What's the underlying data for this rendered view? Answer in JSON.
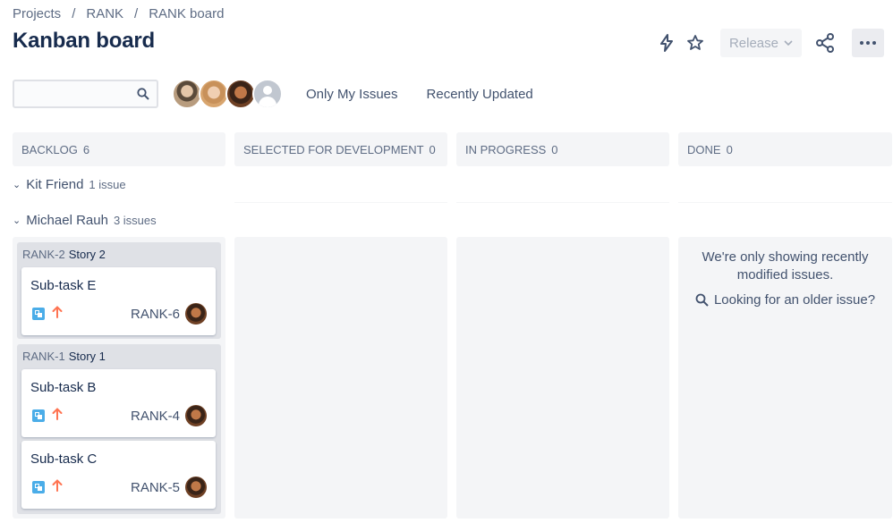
{
  "breadcrumb": [
    "Projects",
    "RANK",
    "RANK board"
  ],
  "page_title": "Kanban board",
  "toolbar": {
    "release_label": "Release",
    "icons": [
      "lightning-icon",
      "star-icon",
      "chevron-down-icon",
      "share-icon",
      "more-icon"
    ]
  },
  "filters": {
    "search_placeholder": "",
    "quick_filters": [
      "Only My Issues",
      "Recently Updated"
    ]
  },
  "columns": [
    {
      "name": "BACKLOG",
      "count": "6"
    },
    {
      "name": "SELECTED FOR DEVELOPMENT",
      "count": "0"
    },
    {
      "name": "IN PROGRESS",
      "count": "0"
    },
    {
      "name": "DONE",
      "count": "0"
    }
  ],
  "swimlanes": [
    {
      "name": "Kit Friend",
      "count": "1 issue"
    },
    {
      "name": "Michael Rauh",
      "count": "3 issues"
    }
  ],
  "parents": [
    {
      "key": "RANK-2",
      "summary": "Story 2",
      "cards": [
        {
          "title": "Sub-task E",
          "key": "RANK-6"
        }
      ]
    },
    {
      "key": "RANK-1",
      "summary": "Story 1",
      "cards": [
        {
          "title": "Sub-task B",
          "key": "RANK-4"
        },
        {
          "title": "Sub-task C",
          "key": "RANK-5"
        }
      ]
    }
  ],
  "done_message": "We're only showing recently modified issues.",
  "done_link": "Looking for an older issue?",
  "colors": {
    "accent_text": "#172b4d",
    "secondary_text": "#5e6c84",
    "column_bg": "#f4f5f7",
    "subtask_icon": "#4bade8",
    "priority_high": "#ff7452"
  }
}
